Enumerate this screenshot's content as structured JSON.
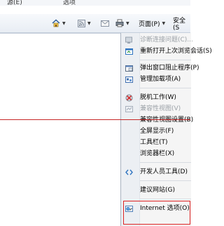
{
  "top_fragments": [
    "源(E)",
    "选项"
  ],
  "toolbar": {
    "home_icon": "home-icon",
    "rss_icon": "rss-icon",
    "mail_icon": "mail-icon",
    "print_icon": "print-icon",
    "page_label": "页面(P)",
    "safety_label": "安全(S"
  },
  "menu": {
    "items": [
      {
        "label": "诊断连接问题(C)...",
        "icon": "diagnose-icon",
        "disabled": true
      },
      {
        "label": "重新打开上次浏览会话(S)",
        "icon": "reopen-session-icon",
        "disabled": false
      },
      {
        "label": "弹出窗口阻止程序(P)",
        "icon": "popup-blocker-icon",
        "disabled": false
      },
      {
        "label": "管理加载项(A)",
        "icon": "addons-icon",
        "disabled": false
      },
      {
        "label": "脱机工作(W)",
        "icon": "offline-icon",
        "disabled": false
      },
      {
        "label": "兼容性视图(V)",
        "icon": "compat-view-icon",
        "disabled": true
      },
      {
        "label": "兼容性视图设置(B)",
        "icon": "",
        "disabled": false
      },
      {
        "label": "全屏显示(F)",
        "icon": "",
        "disabled": false
      },
      {
        "label": "工具栏(T)",
        "icon": "",
        "disabled": false
      },
      {
        "label": "浏览器栏(X)",
        "icon": "",
        "disabled": false
      },
      {
        "label": "开发人员工具(D)",
        "icon": "dev-tools-icon",
        "disabled": false
      },
      {
        "label": "建议网站(G)",
        "icon": "",
        "disabled": false
      },
      {
        "label": "Internet 选项(O)",
        "icon": "internet-options-icon",
        "disabled": false
      }
    ]
  },
  "colors": {
    "annotation_red": "#d22222",
    "menu_bg": "#f5f5f5",
    "toolbar_bg": "#e8edf4"
  }
}
